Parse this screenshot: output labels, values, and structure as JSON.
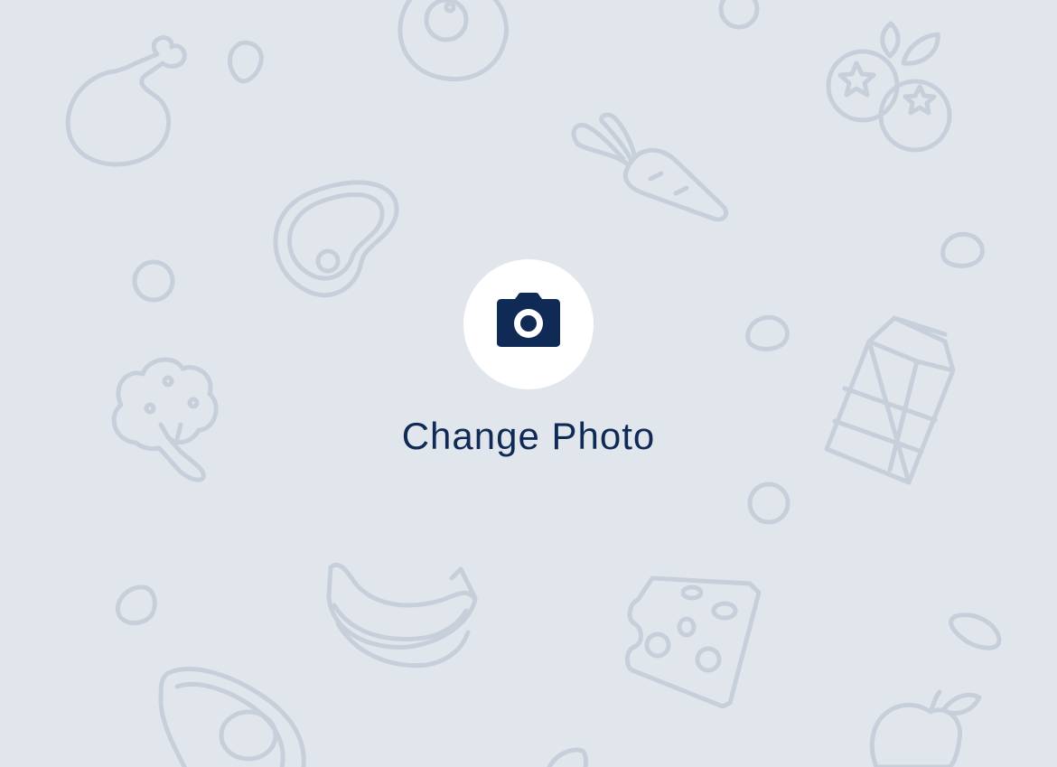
{
  "profile_photo": {
    "change_label": "Change Photo",
    "camera_icon": "camera-icon"
  },
  "background": {
    "pattern": "food-doodle-pattern",
    "doodles": [
      "chicken-leg-icon",
      "egg-icon",
      "blueberries-icon",
      "carrot-icon",
      "steak-icon",
      "broccoli-icon",
      "milk-carton-icon",
      "banana-icon",
      "cheese-icon",
      "avocado-icon",
      "apple-icon"
    ]
  },
  "colors": {
    "background": "#e1e6ed",
    "doodle_stroke": "#c7d0da",
    "button_fill": "#ffffff",
    "accent": "#102a56"
  }
}
